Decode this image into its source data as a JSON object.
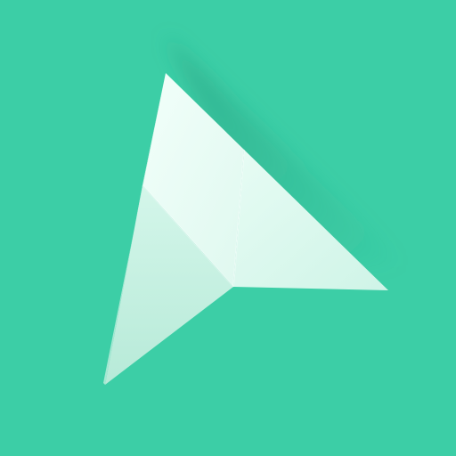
{
  "icon": {
    "name": "paper-plane-cursor-icon",
    "colors": {
      "background": "#3ccea6",
      "plane_top_left": "#e6fbf3",
      "plane_top_right": "#d7f7ec",
      "plane_bottom": "#c6f1e2",
      "plane_bottom_left": "#b8ecd9",
      "shadow": "#1f8a6c"
    }
  }
}
